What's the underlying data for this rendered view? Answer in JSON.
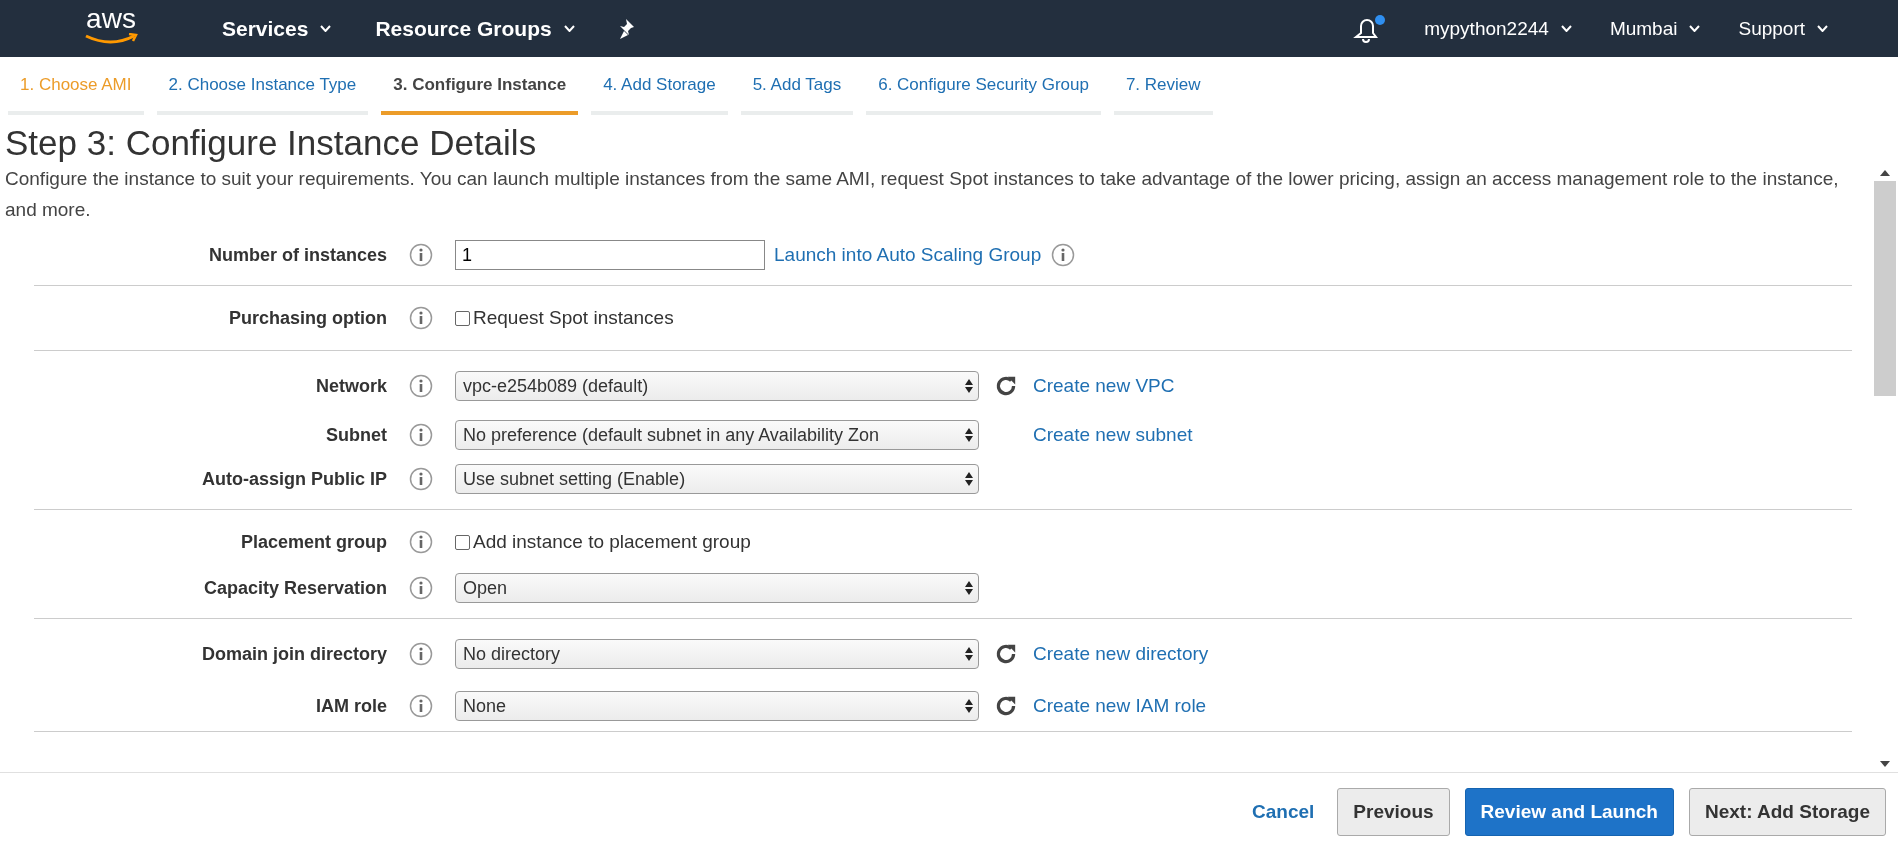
{
  "navbar": {
    "logo": "aws",
    "menus": [
      {
        "label": "Services"
      },
      {
        "label": "Resource Groups"
      }
    ],
    "notifications": {
      "unread": true
    },
    "account_menus": [
      {
        "label": "mypython2244"
      },
      {
        "label": "Mumbai"
      },
      {
        "label": "Support"
      }
    ]
  },
  "steps": [
    {
      "label": "1. Choose AMI",
      "selected": false,
      "completed": true
    },
    {
      "label": "2. Choose Instance Type",
      "selected": false,
      "completed": false
    },
    {
      "label": "3. Configure Instance",
      "selected": true,
      "completed": false
    },
    {
      "label": "4. Add Storage",
      "selected": false,
      "completed": false
    },
    {
      "label": "5. Add Tags",
      "selected": false,
      "completed": false
    },
    {
      "label": "6. Configure Security Group",
      "selected": false,
      "completed": false
    },
    {
      "label": "7. Review",
      "selected": false,
      "completed": false
    }
  ],
  "heading": "Step 3: Configure Instance Details",
  "description": "Configure the instance to suit your requirements. You can launch multiple instances from the same AMI, request Spot instances to take advantage of the lower pricing, assign an access management role to the instance, and more.",
  "sections": [
    {
      "rows": [
        {
          "label": "Number of instances",
          "kind": "input",
          "value": "1",
          "link": "Launch into Auto Scaling Group",
          "link_info": true
        }
      ]
    },
    {
      "rows": [
        {
          "label": "Purchasing option",
          "kind": "checkbox",
          "value": "Request Spot instances",
          "checked": false
        }
      ]
    },
    {
      "rows": [
        {
          "label": "Network",
          "kind": "select",
          "value": "vpc-e254b089 (default)",
          "refresh": true,
          "link": "Create new VPC"
        },
        {
          "label": "Subnet",
          "kind": "select",
          "value": "No preference (default subnet in any Availability Zon",
          "refresh": false,
          "link": "Create new subnet"
        },
        {
          "label": "Auto-assign Public IP",
          "kind": "select",
          "value": "Use subnet setting (Enable)",
          "refresh": false
        }
      ]
    },
    {
      "rows": [
        {
          "label": "Placement group",
          "kind": "checkbox",
          "value": "Add instance to placement group",
          "checked": false
        },
        {
          "label": "Capacity Reservation",
          "kind": "select",
          "value": "Open",
          "refresh": false
        }
      ]
    },
    {
      "rows": [
        {
          "label": "Domain join directory",
          "kind": "select",
          "value": "No directory",
          "refresh": true,
          "link": "Create new directory"
        },
        {
          "label": "IAM role",
          "kind": "select",
          "value": "None",
          "refresh": true,
          "link": "Create new IAM role"
        }
      ]
    }
  ],
  "footer": {
    "cancel": "Cancel",
    "buttons": [
      {
        "label": "Previous",
        "primary": false
      },
      {
        "label": "Review and Launch",
        "primary": true
      },
      {
        "label": "Next: Add Storage",
        "primary": false
      }
    ]
  }
}
